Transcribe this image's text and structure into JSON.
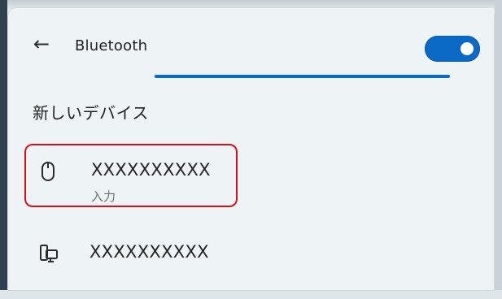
{
  "header": {
    "back_label": "←",
    "title": "Bluetooth"
  },
  "bluetooth_toggle": {
    "state": "on"
  },
  "progress": {
    "fraction": 1.0
  },
  "section": {
    "title": "新しいデバイス"
  },
  "devices": [
    {
      "name": "XXXXXXXXXX",
      "type_label": "入力",
      "icon": "mouse-icon",
      "selected": true
    },
    {
      "name": "XXXXXXXXXX",
      "type_label": "",
      "icon": "computer-icon",
      "selected": false
    }
  ],
  "colors": {
    "accent": "#0a69c5",
    "highlight_border": "#d60f1b",
    "background": "#eef3f6"
  }
}
